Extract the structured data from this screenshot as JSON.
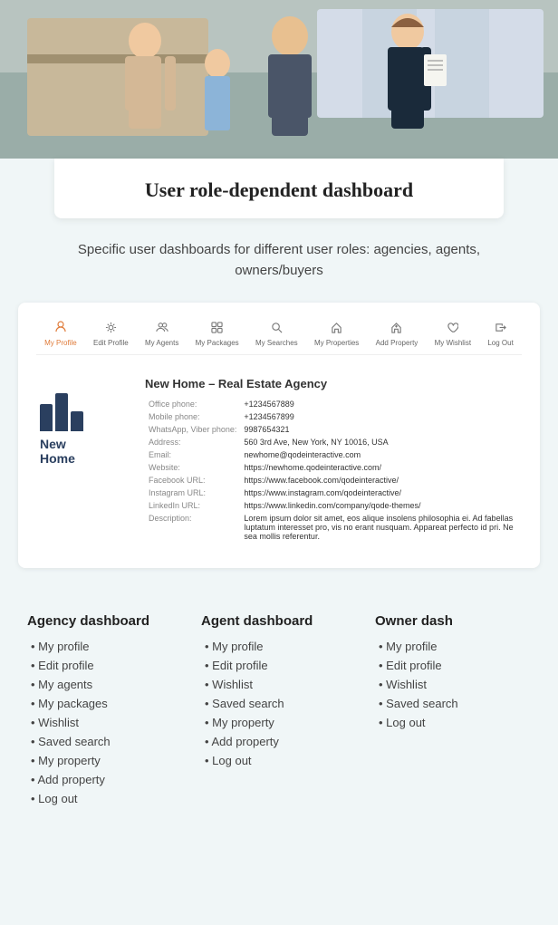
{
  "hero": {
    "alt": "Family with real estate agent"
  },
  "title_section": {
    "title": "User role-dependent dashboard"
  },
  "subtitle_section": {
    "text": "Specific user dashboards for different user roles: agencies, agents, owners/buyers"
  },
  "nav": {
    "items": [
      {
        "label": "My Profile",
        "icon": "👤",
        "active": true
      },
      {
        "label": "Edit Profile",
        "icon": "⚙️",
        "active": false
      },
      {
        "label": "My Agents",
        "icon": "👥",
        "active": false
      },
      {
        "label": "My Packages",
        "icon": "🗂️",
        "active": false
      },
      {
        "label": "My Searches",
        "icon": "🔍",
        "active": false
      },
      {
        "label": "My Properties",
        "icon": "🏠",
        "active": false
      },
      {
        "label": "Add Property",
        "icon": "➕",
        "active": false
      },
      {
        "label": "My Wishlist",
        "icon": "♡",
        "active": false
      },
      {
        "label": "Log Out",
        "icon": "↪",
        "active": false
      }
    ]
  },
  "agency": {
    "name": "New Home – Real Estate Agency",
    "logo_text": "New\nHome",
    "fields": [
      {
        "label": "Office phone:",
        "value": "+1234567889"
      },
      {
        "label": "Mobile phone:",
        "value": "+1234567899"
      },
      {
        "label": "WhatsApp, Viber phone:",
        "value": "9987654321"
      },
      {
        "label": "Address:",
        "value": "560 3rd Ave, New York, NY 10016, USA"
      },
      {
        "label": "Email:",
        "value": "newhome@qodeinteractive.com"
      },
      {
        "label": "Website:",
        "value": "https://newhome.qodeinteractive.com/"
      },
      {
        "label": "Facebook URL:",
        "value": "https://www.facebook.com/qodeinteractive/"
      },
      {
        "label": "Instagram URL:",
        "value": "https://www.instagram.com/qodeinteractive/"
      },
      {
        "label": "LinkedIn URL:",
        "value": "https://www.linkedin.com/company/qode-themes/"
      },
      {
        "label": "Description:",
        "value": "Lorem ipsum dolor sit amet, eos alique insolens philosophia ei. Ad fabellas luptatum interesset pro, vis no erant nusquam. Appareat perfecto id pri. Ne sea mollis referentur."
      }
    ]
  },
  "columns": {
    "agency": {
      "title": "Agency dashboard",
      "items": [
        "My profile",
        "Edit profile",
        "My agents",
        "My packages",
        "Wishlist",
        "Saved search",
        "My property",
        "Add property",
        "Log out"
      ]
    },
    "agent": {
      "title": "Agent dashboard",
      "items": [
        "My profile",
        "Edit profile",
        "Wishlist",
        "Saved search",
        "My property",
        "Add property",
        "Log out"
      ]
    },
    "owner": {
      "title": "Owner dash",
      "items": [
        "My profile",
        "Edit profile",
        "Wishlist",
        "Saved search",
        "Log out"
      ]
    }
  }
}
